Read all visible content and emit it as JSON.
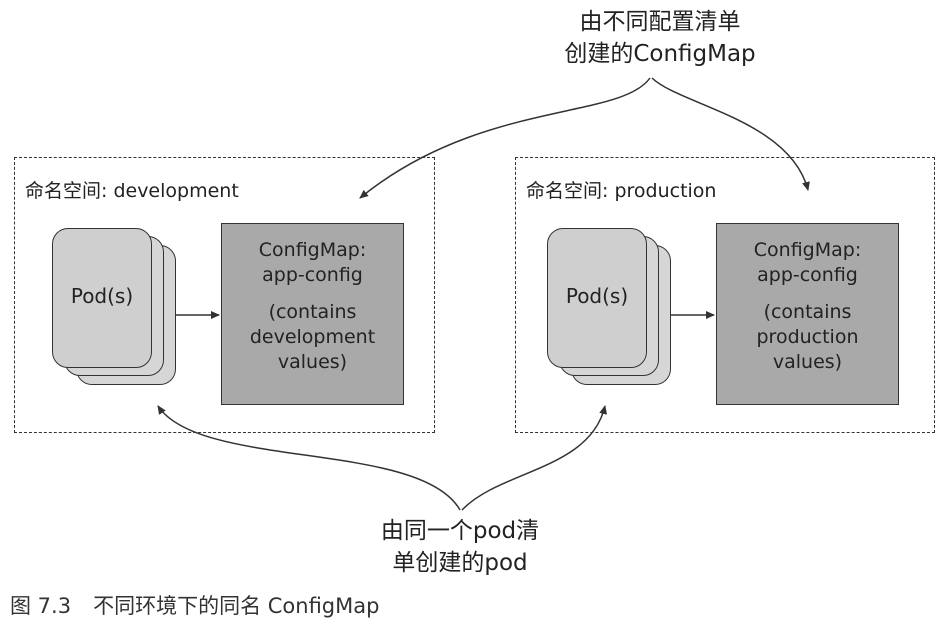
{
  "top_note": {
    "line1": "由不同配置清单",
    "line2": "创建的ConfigMap"
  },
  "bottom_note": {
    "line1": "由同一个pod清",
    "line2": "单创建的pod"
  },
  "namespaces": [
    {
      "label": "命名空间: development",
      "pod_label": "Pod(s)",
      "configmap_title": "ConfigMap:",
      "configmap_name": "app-config",
      "configmap_desc": [
        "(contains",
        "development",
        "values)"
      ]
    },
    {
      "label": "命名空间: production",
      "pod_label": "Pod(s)",
      "configmap_title": "ConfigMap:",
      "configmap_name": "app-config",
      "configmap_desc": [
        "(contains",
        "production",
        "values)"
      ]
    }
  ],
  "caption": {
    "number": "图 7.3",
    "text": "不同环境下的同名 ConfigMap"
  },
  "colors": {
    "configmap_fill": "#a9a9a9",
    "pod_fill": "#d6d6d6",
    "line": "#333333"
  }
}
